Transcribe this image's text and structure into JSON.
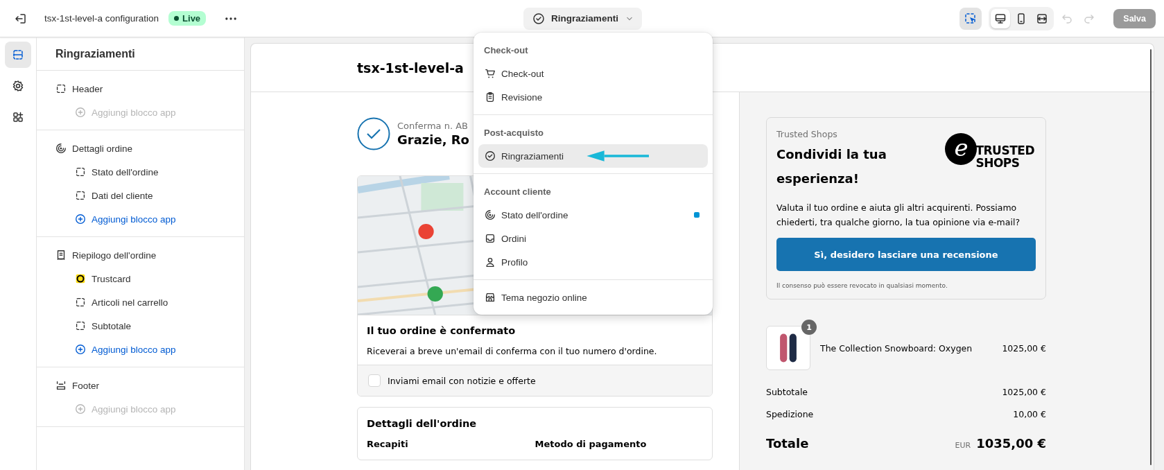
{
  "topbar": {
    "title": "tsx-1st-level-a configuration",
    "status_badge": "Live",
    "page_selector": "Ringraziamenti",
    "inspector_on": true,
    "views": [
      {
        "kind": "desktop",
        "selected": true
      },
      {
        "kind": "mobile",
        "selected": false
      },
      {
        "kind": "fullwidth",
        "selected": false
      }
    ],
    "undo_disabled": true,
    "redo_disabled": true,
    "save_button": {
      "label": "Salva",
      "disabled": true
    }
  },
  "rail": [
    {
      "kind": "sections",
      "selected": true
    },
    {
      "kind": "settings",
      "selected": false
    },
    {
      "kind": "apps",
      "selected": false
    }
  ],
  "sidebar": {
    "title": "Ringraziamenti",
    "sections": [
      {
        "label": "Header",
        "items": [
          {
            "kind": "add",
            "label": "Aggiungi blocco app",
            "disabled": true
          }
        ]
      },
      {
        "label": "Dettagli ordine",
        "items": [
          {
            "kind": "block",
            "label": "Stato dell'ordine"
          },
          {
            "kind": "block",
            "label": "Dati del cliente"
          },
          {
            "kind": "add",
            "label": "Aggiungi blocco app",
            "disabled": false
          }
        ]
      },
      {
        "label": "Riepilogo dell'ordine",
        "items": [
          {
            "kind": "app",
            "label": "Trustcard"
          },
          {
            "kind": "block",
            "label": "Articoli nel carrello"
          },
          {
            "kind": "block",
            "label": "Subtotale"
          },
          {
            "kind": "add",
            "label": "Aggiungi blocco app",
            "disabled": false
          }
        ]
      },
      {
        "label": "Footer",
        "items": [
          {
            "kind": "add",
            "label": "Aggiungi blocco app",
            "disabled": true
          }
        ]
      }
    ]
  },
  "dropdown": {
    "groups": [
      {
        "title": "Check-out",
        "items": [
          {
            "label": "Check-out",
            "selected": false,
            "indicator": false
          },
          {
            "label": "Revisione",
            "selected": false,
            "indicator": false
          }
        ]
      },
      {
        "title": "Post-acquisto",
        "items": [
          {
            "label": "Ringraziamenti",
            "selected": true,
            "indicator": false
          }
        ]
      },
      {
        "title": "Account cliente",
        "items": [
          {
            "label": "Stato dell'ordine",
            "selected": false,
            "indicator": true
          },
          {
            "label": "Ordini",
            "selected": false,
            "indicator": false
          },
          {
            "label": "Profilo",
            "selected": false,
            "indicator": false
          }
        ]
      },
      {
        "items": [
          {
            "label": "Tema negozio online",
            "selected": false,
            "indicator": false
          }
        ]
      }
    ]
  },
  "preview": {
    "store_name": "tsx-1st-level-a",
    "confirmation": "Conferma n. AB",
    "greeting": "Grazie, Ro",
    "status_card": {
      "title": "Il tuo ordine è confermato",
      "text": "Riceverai a breve un'email di conferma con il tuo numero d'ordine.",
      "checkbox": {
        "label": "Inviami email con notizie e offerte",
        "checked": false
      }
    },
    "details_card": {
      "title": "Dettagli dell'ordine",
      "columns": [
        "Recapiti",
        "Metodo di pagamento"
      ]
    },
    "review_card": {
      "provider": "Trusted Shops",
      "title": "Condividi la tua esperienza!",
      "logo": {
        "mark": "e",
        "lines": [
          "TRUSTED",
          "SHOPS"
        ]
      },
      "text": "Valuta il tuo ordine e aiuta gli altri acquirenti. Possiamo chiederti, tra qualche giorno, la tua opinione via e-mail?",
      "button": "Sì, desidero lasciare una recensione",
      "note": "Il consenso può essere revocato in qualsiasi momento."
    },
    "line_items": [
      {
        "name": "The Collection Snowboard: Oxygen",
        "quantity": "1",
        "price": "1025,00 €"
      }
    ],
    "summary": [
      {
        "label": "Subtotale",
        "value": "1025,00 €"
      },
      {
        "label": "Spedizione",
        "value": "10,00 €"
      }
    ],
    "total": {
      "label": "Totale",
      "currency": "EUR",
      "value": "1035,00 €"
    }
  }
}
